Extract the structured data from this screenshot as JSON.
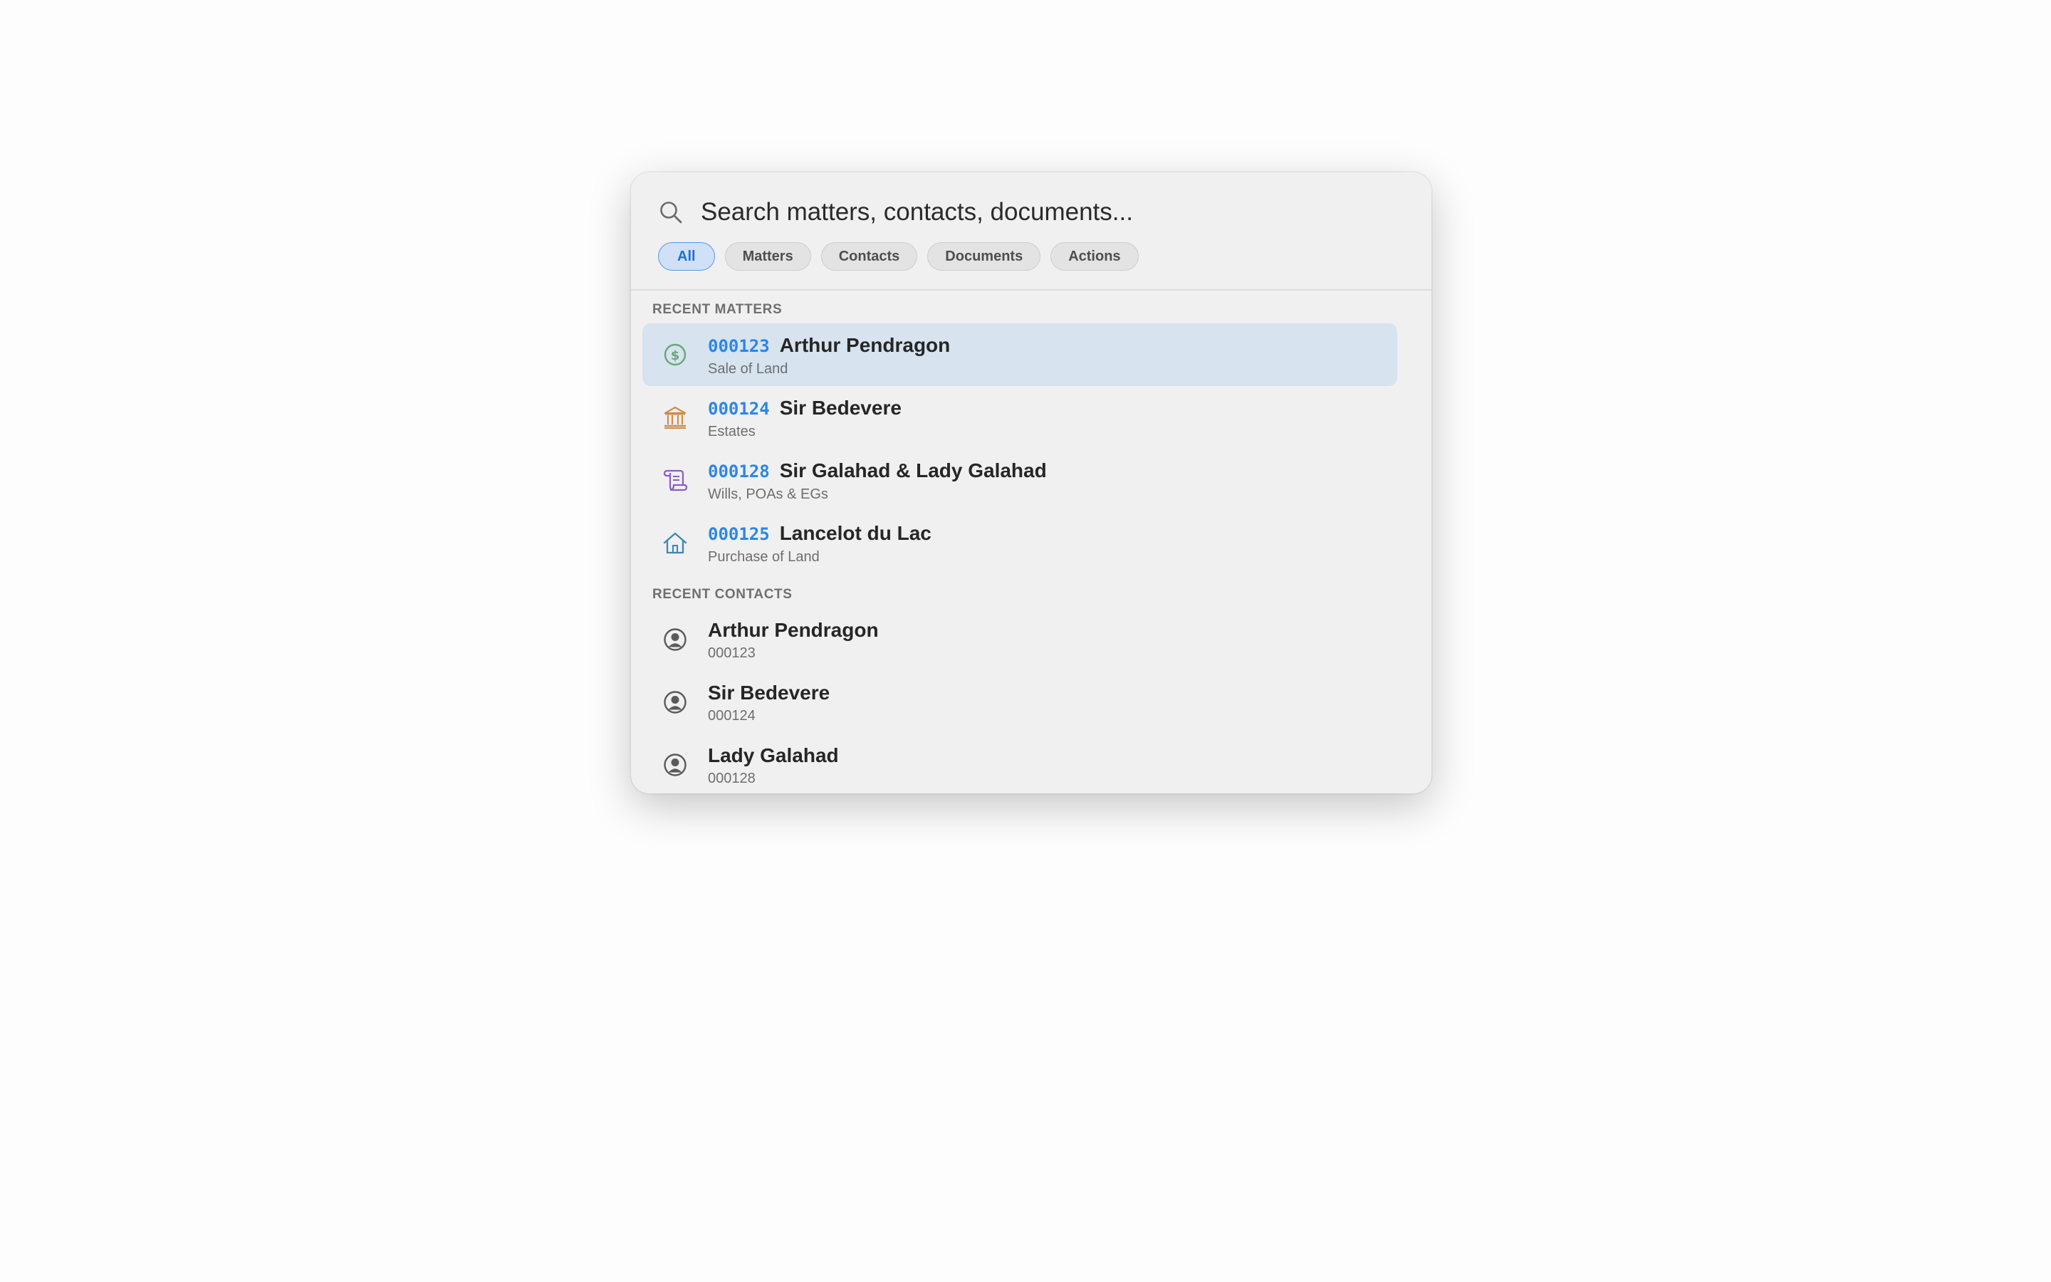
{
  "search": {
    "placeholder": "Search matters, contacts, documents..."
  },
  "filters": [
    {
      "label": "All",
      "active": true
    },
    {
      "label": "Matters",
      "active": false
    },
    {
      "label": "Contacts",
      "active": false
    },
    {
      "label": "Documents",
      "active": false
    },
    {
      "label": "Actions",
      "active": false
    }
  ],
  "recent_matters": {
    "label": "RECENT MATTERS",
    "items": [
      {
        "id": "000123",
        "name": "Arthur Pendragon",
        "type": "Sale of Land",
        "icon": "dollar-circle-icon",
        "icon_color": "#6aa57a",
        "selected": true
      },
      {
        "id": "000124",
        "name": "Sir Bedevere",
        "type": "Estates",
        "icon": "bank-icon",
        "icon_color": "#d08c4a",
        "selected": false
      },
      {
        "id": "000128",
        "name": "Sir Galahad & Lady Galahad",
        "type": "Wills, POAs & EGs",
        "icon": "scroll-icon",
        "icon_color": "#8a5cc9",
        "selected": false
      },
      {
        "id": "000125",
        "name": "Lancelot du Lac",
        "type": "Purchase of Land",
        "icon": "house-icon",
        "icon_color": "#3b87b8",
        "selected": false
      }
    ]
  },
  "recent_contacts": {
    "label": "RECENT CONTACTS",
    "items": [
      {
        "name": "Arthur Pendragon",
        "id": "000123",
        "icon": "person-circle-icon",
        "icon_color": "#5a5a5a"
      },
      {
        "name": "Sir Bedevere",
        "id": "000124",
        "icon": "person-circle-icon",
        "icon_color": "#5a5a5a"
      },
      {
        "name": "Lady Galahad",
        "id": "000128",
        "icon": "person-circle-icon",
        "icon_color": "#5a5a5a"
      }
    ]
  },
  "colors": {
    "accent": "#2c86e8",
    "selected_row": "#d7e3ef",
    "panel": "#f0f0f0"
  }
}
